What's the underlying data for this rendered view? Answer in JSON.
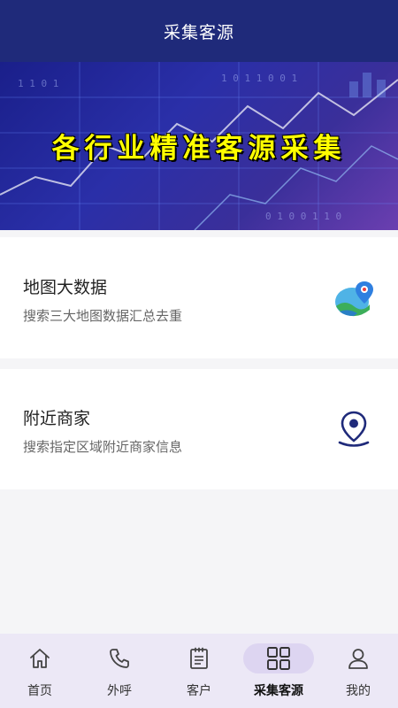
{
  "header": {
    "title": "采集客源"
  },
  "banner": {
    "title": "各行业精准客源采集"
  },
  "cards": [
    {
      "title": "地图大数据",
      "subtitle": "搜索三大地图数据汇总去重",
      "icon": "map-pin-icon"
    },
    {
      "title": "附近商家",
      "subtitle": "搜索指定区域附近商家信息",
      "icon": "location-pin-icon"
    }
  ],
  "tabbar": {
    "items": [
      {
        "label": "首页",
        "icon": "home-icon"
      },
      {
        "label": "外呼",
        "icon": "phone-icon"
      },
      {
        "label": "客户",
        "icon": "clipboard-icon"
      },
      {
        "label": "采集客源",
        "icon": "grid-icon",
        "active": true
      },
      {
        "label": "我的",
        "icon": "user-icon"
      }
    ]
  },
  "colors": {
    "header_bg": "#1f2a7a",
    "banner_text": "#ffff00",
    "tabbar_bg": "#ece8f6",
    "tab_active_bg": "#ddd5f1",
    "pin_accent": "#1f2a7a"
  }
}
